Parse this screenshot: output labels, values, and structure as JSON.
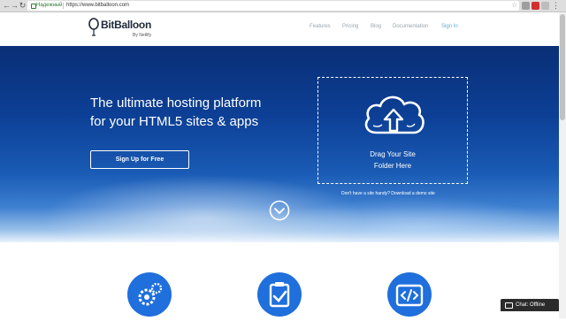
{
  "browser": {
    "secure_label": "Надежный",
    "url": "https://www.bitballoon.com"
  },
  "header": {
    "logo_name": "BitBalloon",
    "logo_byline": "By Netlify",
    "nav": [
      {
        "label": "Features"
      },
      {
        "label": "Pricing"
      },
      {
        "label": "Blog"
      },
      {
        "label": "Documentation"
      },
      {
        "label": "Sign In"
      }
    ]
  },
  "hero": {
    "headline_line1": "The ultimate hosting platform",
    "headline_line2": "for your HTML5 sites & apps",
    "signup_label": "Sign Up for Free",
    "drop_line1": "Drag Your Site",
    "drop_line2": "Folder Here",
    "demo_text": "Don't have a site handy? Download a demo site"
  },
  "features": [
    {
      "icon": "gears-icon"
    },
    {
      "icon": "clipboard-check-icon"
    },
    {
      "icon": "code-icon"
    }
  ],
  "chat": {
    "label": "Chat: Offline"
  },
  "colors": {
    "hero_top": "#0a2f76",
    "hero_bottom": "#9cc2ea",
    "feature_circle": "#1f6fdc",
    "nav_text": "#9aa4ad",
    "sign_in": "#5fa9d6"
  }
}
